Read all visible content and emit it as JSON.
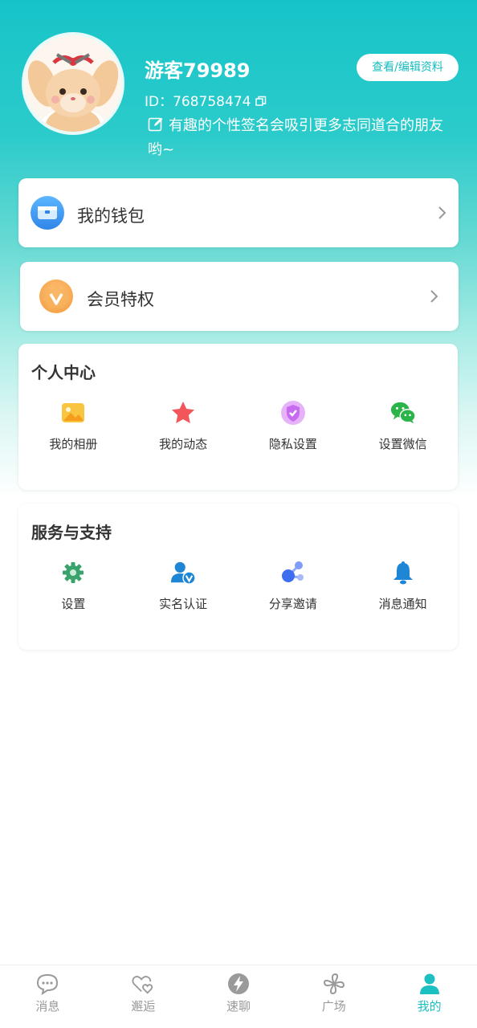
{
  "profile": {
    "username": "游客79989",
    "id_text": "ID：768758474",
    "signature": "有趣的个性签名会吸引更多志同道合的朋友哟~",
    "edit_label": "查看/编辑资料"
  },
  "wallet": {
    "label": "我的钱包",
    "icon": "wallet-icon"
  },
  "vip": {
    "label": "会员特权",
    "icon": "vip-icon"
  },
  "personal_center": {
    "title": "个人中心",
    "items": [
      {
        "label": "我的相册",
        "icon": "photo-album-icon",
        "color": "#f7b731"
      },
      {
        "label": "我的动态",
        "icon": "star-icon",
        "color": "#f2555a"
      },
      {
        "label": "隐私设置",
        "icon": "privacy-shield-icon",
        "color": "#c86bf0"
      },
      {
        "label": "设置微信",
        "icon": "wechat-icon",
        "color": "#2ab44a"
      }
    ]
  },
  "service_support": {
    "title": "服务与支持",
    "items": [
      {
        "label": "设置",
        "icon": "gear-icon",
        "color": "#3aa36b"
      },
      {
        "label": "实名认证",
        "icon": "verified-user-icon",
        "color": "#1f86d6"
      },
      {
        "label": "分享邀请",
        "icon": "share-icon",
        "color": "#3e6ef0"
      },
      {
        "label": "消息通知",
        "icon": "bell-icon",
        "color": "#1f86d6"
      }
    ]
  },
  "tabbar": {
    "active": "我的",
    "accent": "#1cbfc2",
    "tabs": [
      {
        "label": "消息",
        "icon": "chat-icon"
      },
      {
        "label": "邂逅",
        "icon": "hearts-icon"
      },
      {
        "label": "速聊",
        "icon": "lightning-icon"
      },
      {
        "label": "广场",
        "icon": "pinwheel-icon"
      },
      {
        "label": "我的",
        "icon": "user-icon"
      }
    ]
  }
}
